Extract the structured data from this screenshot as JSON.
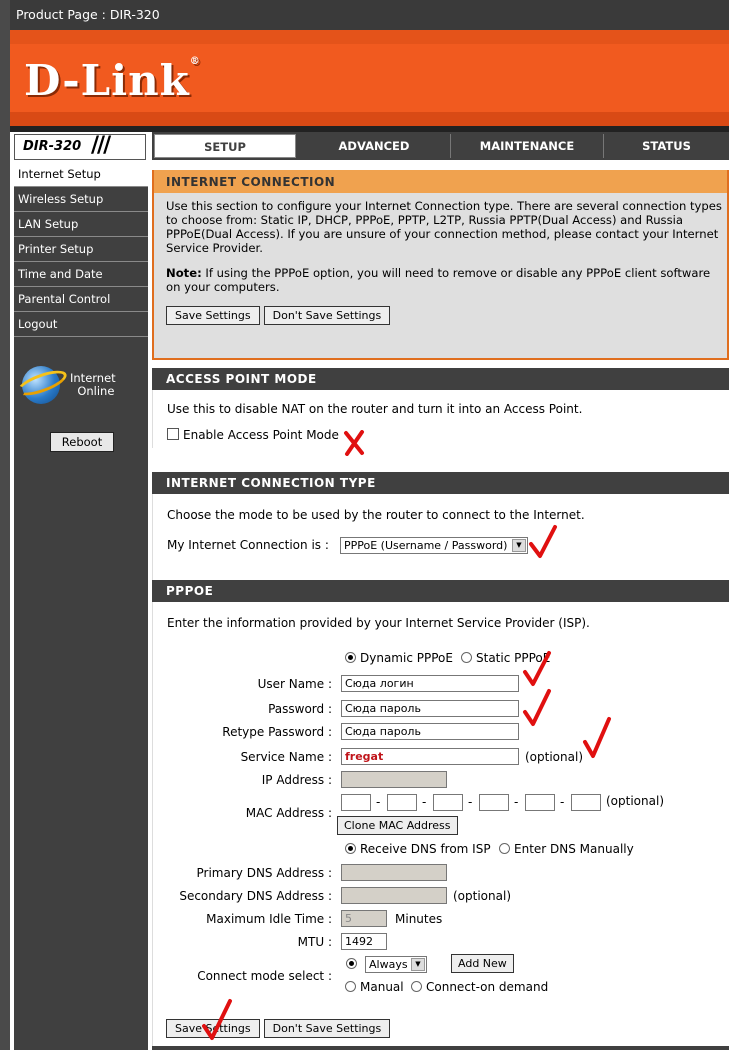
{
  "top_bar": {
    "title": "Product Page : DIR-320"
  },
  "logo": {
    "text": "D-Link",
    "trademark": "®"
  },
  "model": {
    "name": "DIR-320",
    "slashes": "///"
  },
  "tabs": [
    {
      "label": "SETUP",
      "active": true
    },
    {
      "label": "ADVANCED",
      "active": false
    },
    {
      "label": "MAINTENANCE",
      "active": false
    },
    {
      "label": "STATUS",
      "active": false
    }
  ],
  "sidebar": {
    "items": [
      {
        "label": "Internet Setup",
        "active": true
      },
      {
        "label": "Wireless Setup"
      },
      {
        "label": "LAN Setup"
      },
      {
        "label": "Printer Setup"
      },
      {
        "label": "Time and Date"
      },
      {
        "label": "Parental Control"
      },
      {
        "label": "Logout"
      }
    ],
    "status_line1": "Internet",
    "status_line2": "Online",
    "reboot_label": "Reboot"
  },
  "internet_connection": {
    "title": "INTERNET CONNECTION",
    "desc": "Use this section to configure your Internet Connection type. There are several connection types to choose from: Static IP, DHCP, PPPoE, PPTP, L2TP, Russia PPTP(Dual Access) and Russia PPPoE(Dual Access). If you are unsure of your connection method, please contact your Internet Service Provider.",
    "note_label": "Note:",
    "note_text": " If using the PPPoE option, you will need to remove or disable any PPPoE client software on your computers.",
    "save_label": "Save Settings",
    "dont_save_label": "Don't Save Settings"
  },
  "access_point": {
    "title": "ACCESS POINT MODE",
    "desc": "Use this to disable NAT on the router and turn it into an Access Point.",
    "checkbox_label": "Enable Access Point Mode",
    "checked": false
  },
  "connection_type": {
    "title": "INTERNET CONNECTION TYPE",
    "desc": "Choose the mode to be used by the router to connect to the Internet.",
    "label": "My Internet Connection is :",
    "value": "PPPoE (Username / Password)"
  },
  "pppoe": {
    "title": "PPPOE",
    "desc": "Enter the information provided by your Internet Service Provider (ISP).",
    "dynamic_label": "Dynamic PPPoE",
    "static_label": "Static PPPoE",
    "user_name_label": "User Name :",
    "user_name_value": "Сюда логин",
    "password_label": "Password :",
    "password_value": "Сюда пароль",
    "retype_label": "Retype Password :",
    "retype_value": "Сюда пароль",
    "service_label": "Service Name :",
    "service_value": "fregat",
    "optional_label": "(optional)",
    "ip_label": "IP Address :",
    "mac_label": "MAC Address :",
    "mac_sep": "-",
    "clone_mac_label": "Clone MAC Address",
    "receive_dns_label": "Receive DNS from ISP",
    "manual_dns_label": "Enter DNS Manually",
    "primary_dns_label": "Primary DNS Address :",
    "secondary_dns_label": "Secondary DNS Address :",
    "idle_label": "Maximum Idle Time :",
    "idle_value": "5",
    "minutes_label": "Minutes",
    "mtu_label": "MTU :",
    "mtu_value": "1492",
    "connect_mode_label": "Connect mode select :",
    "connect_always": "Always",
    "add_new_label": "Add New",
    "manual_label": "Manual",
    "on_demand_label": "Connect-on demand",
    "save_label": "Save Settings",
    "dont_save_label": "Don't Save Settings"
  },
  "colors": {
    "accent": "#f15a1f",
    "header_dark": "#404040",
    "annotation_red": "#e01010"
  }
}
